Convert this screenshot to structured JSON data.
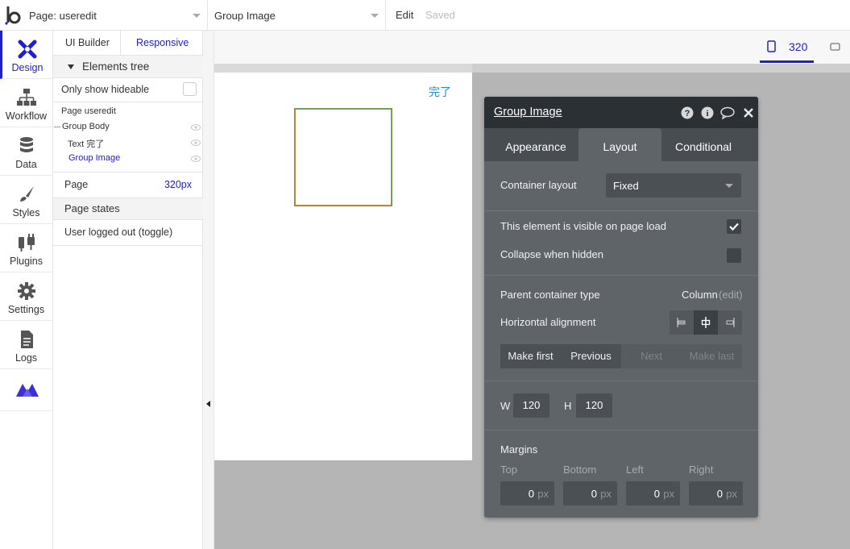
{
  "topbar": {
    "page_select": "Page: useredit",
    "element_select": "Group Image",
    "edit_label": "Edit",
    "saved_label": "Saved"
  },
  "leftnav": {
    "items": [
      {
        "label": "Design",
        "icon": "design-icon",
        "active": true
      },
      {
        "label": "Workflow",
        "icon": "workflow-icon"
      },
      {
        "label": "Data",
        "icon": "database-icon"
      },
      {
        "label": "Styles",
        "icon": "brush-icon"
      },
      {
        "label": "Plugins",
        "icon": "plugin-icon"
      },
      {
        "label": "Settings",
        "icon": "gear-icon"
      },
      {
        "label": "Logs",
        "icon": "document-icon"
      }
    ]
  },
  "treepanel": {
    "tab_ui_builder": "UI Builder",
    "tab_responsive": "Responsive",
    "elements_tree_header": "Elements tree",
    "only_show_hideable": "Only show hideable",
    "tree": {
      "page": "Page useredit",
      "group_body": "Group Body",
      "text_done": "Text 完了",
      "group_image": "Group Image"
    },
    "page_label": "Page",
    "page_value": "320px",
    "page_states_header": "Page states",
    "state_user_logged_out": "User logged out (toggle)"
  },
  "canvas": {
    "width_label": "320",
    "done_text": "完了",
    "colors": {
      "accent": "#1f20c9",
      "done_text": "#1e8fd6",
      "canvas_bg": "#b5b5b5"
    }
  },
  "editor": {
    "title": "Group Image",
    "tabs": {
      "appearance": "Appearance",
      "layout": "Layout",
      "conditional": "Conditional"
    },
    "container_layout_label": "Container layout",
    "container_layout_value": "Fixed",
    "visible_on_load_label": "This element is visible on page load",
    "visible_on_load_checked": true,
    "collapse_when_hidden_label": "Collapse when hidden",
    "collapse_when_hidden_checked": false,
    "parent_container_label": "Parent container type",
    "parent_container_value": "Column",
    "parent_container_edit": "(edit)",
    "horizontal_alignment_label": "Horizontal alignment",
    "order_buttons": {
      "make_first": "Make first",
      "previous": "Previous",
      "next": "Next",
      "make_last": "Make last"
    },
    "width_label": "W",
    "width_value": "120",
    "height_label": "H",
    "height_value": "120",
    "margins_label": "Margins",
    "margins": {
      "top_label": "Top",
      "top_value": "0",
      "bottom_label": "Bottom",
      "bottom_value": "0",
      "left_label": "Left",
      "left_value": "0",
      "right_label": "Right",
      "right_value": "0",
      "unit": "px"
    }
  }
}
